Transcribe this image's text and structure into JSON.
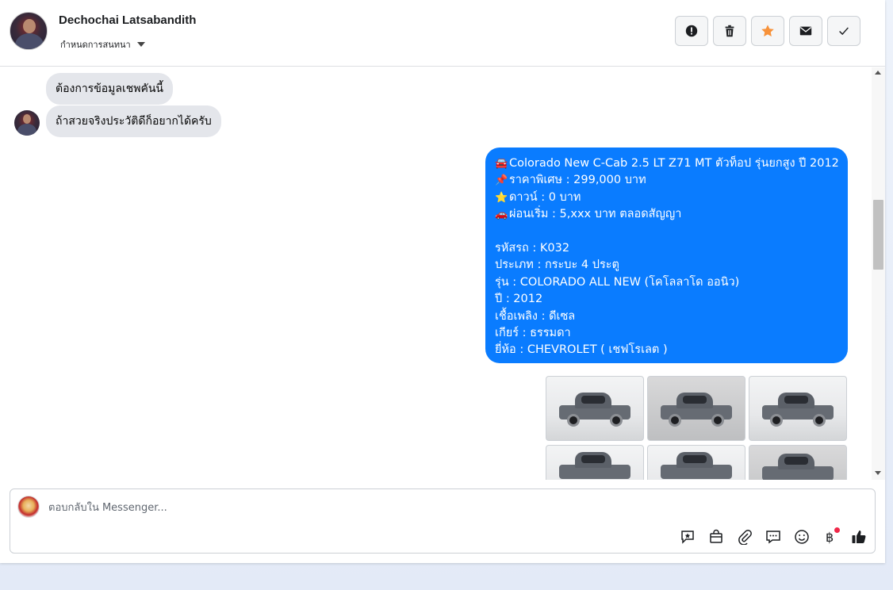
{
  "header": {
    "contact_name": "Dechochai Latsabandith",
    "assign_label": "กำหนดการสนทนา",
    "actions": [
      {
        "name": "mark-spam-button",
        "icon": "alert-icon"
      },
      {
        "name": "delete-button",
        "icon": "trash-icon"
      },
      {
        "name": "star-button",
        "icon": "star-icon",
        "color": "#f7923a"
      },
      {
        "name": "mark-unread-button",
        "icon": "envelope-icon"
      },
      {
        "name": "mark-done-button",
        "icon": "check-icon"
      }
    ]
  },
  "messages": {
    "incoming": [
      "ต้องการข้อมูลเชพคันนี้",
      "ถ้าสวยจริงประวัติดีก็อยากได้ครับ"
    ],
    "outgoing": {
      "lines": [
        {
          "icon": "🚘",
          "text": "Colorado New C-Cab 2.5 LT Z71 MT ตัวท็อป รุ่นยกสูง ปี 2012"
        },
        {
          "icon": "📌",
          "text": " ราคาพิเศษ : 299,000 บาท"
        },
        {
          "icon": "⭐",
          "text": " ดาวน์ : 0 บาท"
        },
        {
          "icon": "🚗",
          "text": " ผ่อนเริ่ม : 5,xxx บาท ตลอดสัญญา"
        }
      ],
      "details": [
        " รหัสรถ : K032",
        "ประเภท : กระบะ 4 ประตู",
        "รุ่น : COLORADO ALL NEW (โคโลลาโด ออนิว)",
        "ปี : 2012",
        "เชื้อเพลิง : ดีเซล",
        "เกียร์ : ธรรมดา",
        "ยี่ห้อ : CHEVROLET ( เชฟโรเลต )"
      ]
    },
    "photos_count_visible": 6
  },
  "composer": {
    "placeholder": "ตอบกลับใน Messenger...",
    "tools": [
      "saved-reply-icon",
      "shop-bag-icon",
      "paperclip-icon",
      "chat-bubbles-icon",
      "emoji-icon",
      "baht-payment-icon",
      "like-thumb-icon"
    ]
  },
  "colors": {
    "accent": "#0a7cff",
    "incoming_bubble": "#e4e6eb",
    "star": "#f7923a"
  }
}
